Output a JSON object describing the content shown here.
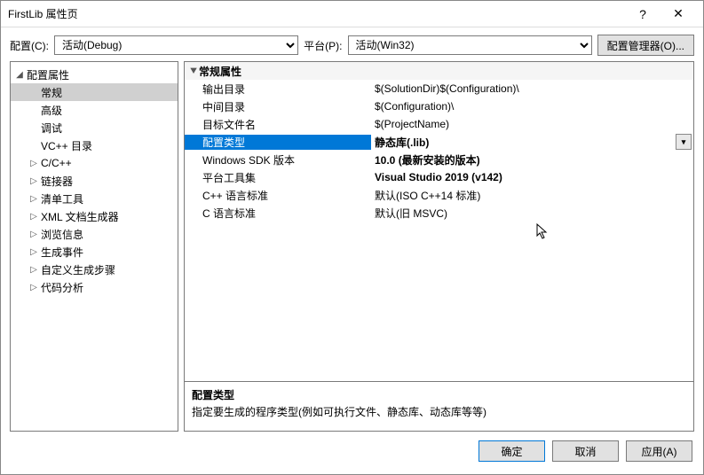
{
  "window": {
    "title": "FirstLib 属性页",
    "help": "?",
    "close": "✕"
  },
  "top": {
    "config_label": "配置(C):",
    "config_value": "活动(Debug)",
    "platform_label": "平台(P):",
    "platform_value": "活动(Win32)",
    "manager_btn": "配置管理器(O)..."
  },
  "tree": {
    "root": "配置属性",
    "items": [
      {
        "label": "常规",
        "leaf": true,
        "selected": true
      },
      {
        "label": "高级",
        "leaf": true
      },
      {
        "label": "调试",
        "leaf": true
      },
      {
        "label": "VC++ 目录",
        "leaf": true
      },
      {
        "label": "C/C++",
        "leaf": false
      },
      {
        "label": "链接器",
        "leaf": false
      },
      {
        "label": "清单工具",
        "leaf": false
      },
      {
        "label": "XML 文档生成器",
        "leaf": false
      },
      {
        "label": "浏览信息",
        "leaf": false
      },
      {
        "label": "生成事件",
        "leaf": false
      },
      {
        "label": "自定义生成步骤",
        "leaf": false
      },
      {
        "label": "代码分析",
        "leaf": false
      }
    ]
  },
  "props": {
    "group": "常规属性",
    "rows": [
      {
        "name": "输出目录",
        "value": "$(SolutionDir)$(Configuration)\\"
      },
      {
        "name": "中间目录",
        "value": "$(Configuration)\\"
      },
      {
        "name": "目标文件名",
        "value": "$(ProjectName)"
      },
      {
        "name": "配置类型",
        "value": "静态库(.lib)",
        "bold": true,
        "selected": true,
        "dropdown": true
      },
      {
        "name": "Windows SDK 版本",
        "value": "10.0 (最新安装的版本)",
        "bold": true
      },
      {
        "name": "平台工具集",
        "value": "Visual Studio 2019 (v142)",
        "bold": true
      },
      {
        "name": "C++ 语言标准",
        "value": "默认(ISO C++14 标准)"
      },
      {
        "name": "C 语言标准",
        "value": "默认(旧 MSVC)"
      }
    ]
  },
  "desc": {
    "title": "配置类型",
    "text": "指定要生成的程序类型(例如可执行文件、静态库、动态库等等)"
  },
  "buttons": {
    "ok": "确定",
    "cancel": "取消",
    "apply": "应用(A)"
  }
}
